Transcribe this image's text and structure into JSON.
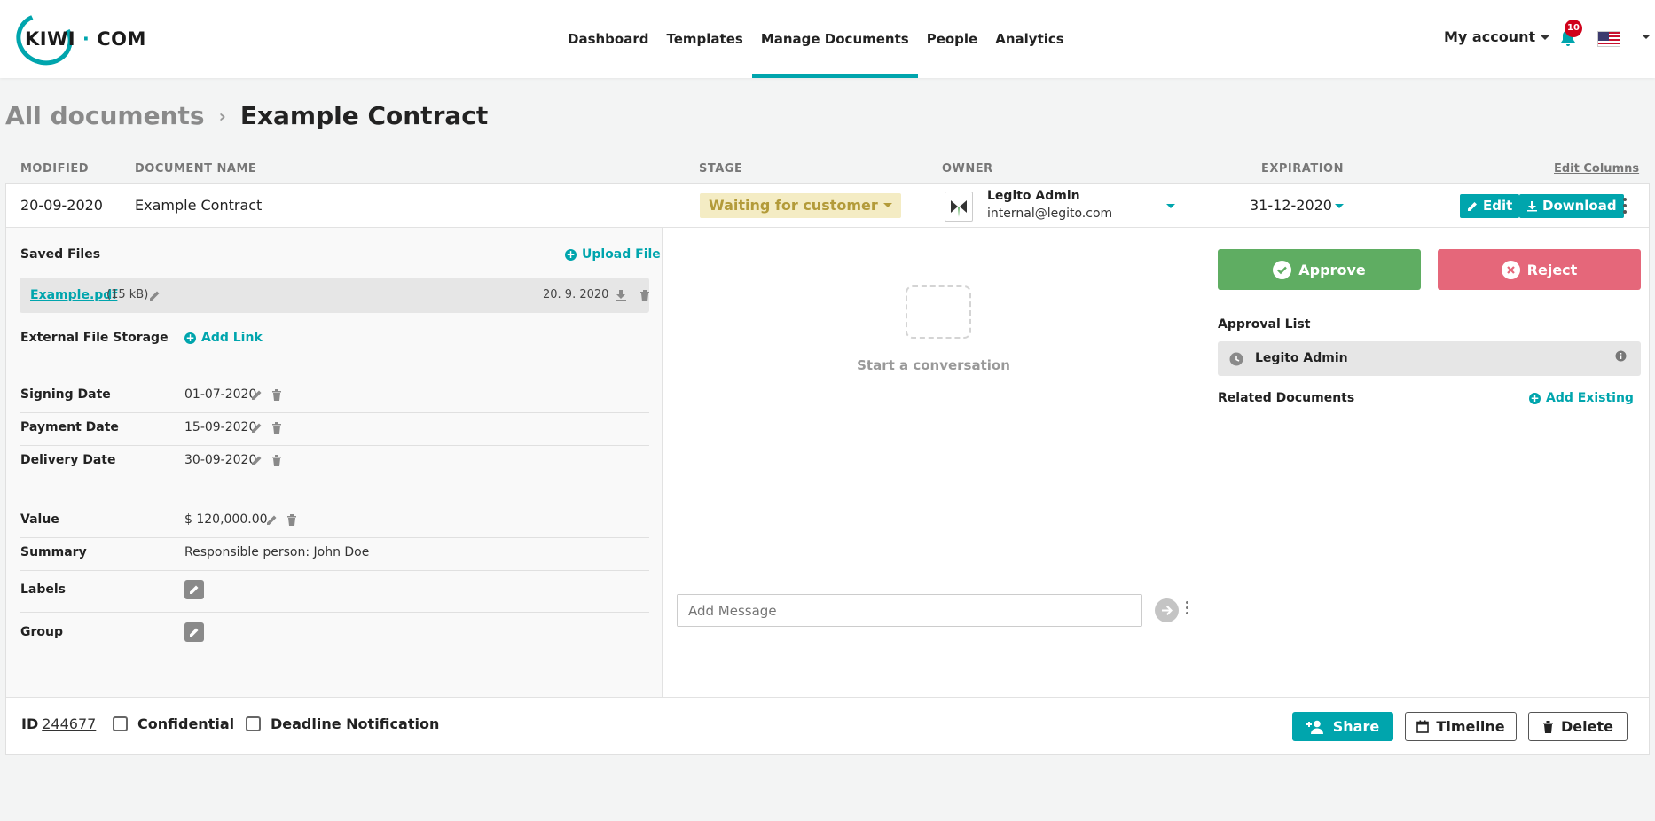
{
  "brand": {
    "logo_text_left": "KIWI",
    "logo_dot": "·",
    "logo_text_right": "COM",
    "accent_color": "#00a5ad"
  },
  "nav": {
    "items": [
      {
        "label": "Dashboard"
      },
      {
        "label": "Templates"
      },
      {
        "label": "Manage Documents",
        "active": true
      },
      {
        "label": "People"
      },
      {
        "label": "Analytics"
      }
    ]
  },
  "account": {
    "label": "My account",
    "notifications": "10",
    "flag": "us-flag-icon"
  },
  "breadcrumb": {
    "root": "All documents",
    "current": "Example Contract"
  },
  "columns": {
    "modified": "MODIFIED",
    "name": "DOCUMENT NAME",
    "stage": "STAGE",
    "owner": "OWNER",
    "expiration": "EXPIRATION",
    "edit_columns": "Edit Columns"
  },
  "document": {
    "modified": "20-09-2020",
    "name": "Example Contract",
    "stage": "Waiting for customer",
    "owner_name": "Legito Admin",
    "owner_email": "internal@legito.com",
    "expiration": "31-12-2020",
    "edit_label": "Edit",
    "download_label": "Download"
  },
  "details": {
    "saved_files_label": "Saved Files",
    "upload_file_label": "Upload File",
    "file_name": "Example.pdf",
    "file_size": "(15 kB)",
    "file_date": "20. 9. 2020",
    "external_storage_label": "External File Storage",
    "add_link_label": "Add Link",
    "signing_date_label": "Signing Date",
    "signing_date": "01-07-2020",
    "payment_date_label": "Payment Date",
    "payment_date": "15-09-2020",
    "delivery_date_label": "Delivery Date",
    "delivery_date": "30-09-2020",
    "value_label": "Value",
    "value": "$ 120,000.00",
    "summary_label": "Summary",
    "summary": "Responsible person: John Doe",
    "labels_label": "Labels",
    "group_label": "Group"
  },
  "conversation": {
    "empty_text": "Start a conversation",
    "message_placeholder": "Add Message"
  },
  "approval": {
    "approve_label": "Approve",
    "reject_label": "Reject",
    "approval_list_label": "Approval List",
    "approver": "Legito Admin",
    "related_documents_label": "Related Documents",
    "add_existing_label": "Add Existing"
  },
  "footer": {
    "id_label": "ID",
    "id_value": "244677",
    "confidential_label": "Confidential",
    "deadline_label": "Deadline Notification",
    "share_label": "Share",
    "timeline_label": "Timeline",
    "delete_label": "Delete"
  }
}
